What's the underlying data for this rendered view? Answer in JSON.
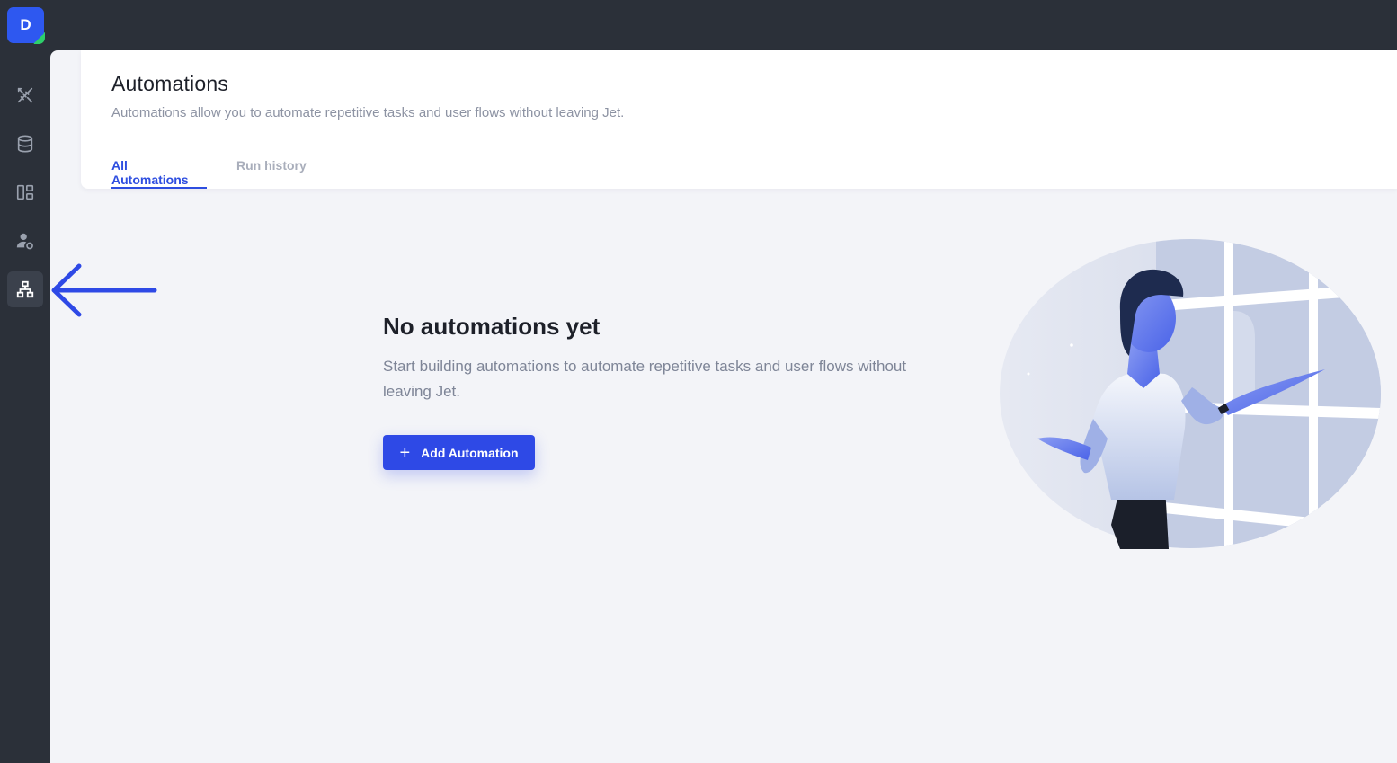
{
  "project": {
    "initial": "D"
  },
  "sidebar": {
    "items": [
      {
        "icon": "builder-icon"
      },
      {
        "icon": "database-icon"
      },
      {
        "icon": "layout-icon"
      },
      {
        "icon": "users-settings-icon"
      },
      {
        "icon": "automations-icon",
        "active": true
      }
    ]
  },
  "header": {
    "title": "Automations",
    "subtitle": "Automations allow you to automate repetitive tasks and user flows without leaving Jet.",
    "tabs": [
      {
        "label": "All Automations",
        "active": true
      },
      {
        "label": "Run history",
        "active": false
      }
    ]
  },
  "empty_state": {
    "title": "No automations yet",
    "description": "Start building automations to automate repetitive tasks and user flows without leaving Jet.",
    "button_label": "Add Automation",
    "button_icon": "plus-icon"
  },
  "colors": {
    "accent": "#2e49e6",
    "sidebar_bg": "#2b3039",
    "content_bg": "#f3f4f8",
    "annotation": "#2e49e6"
  }
}
